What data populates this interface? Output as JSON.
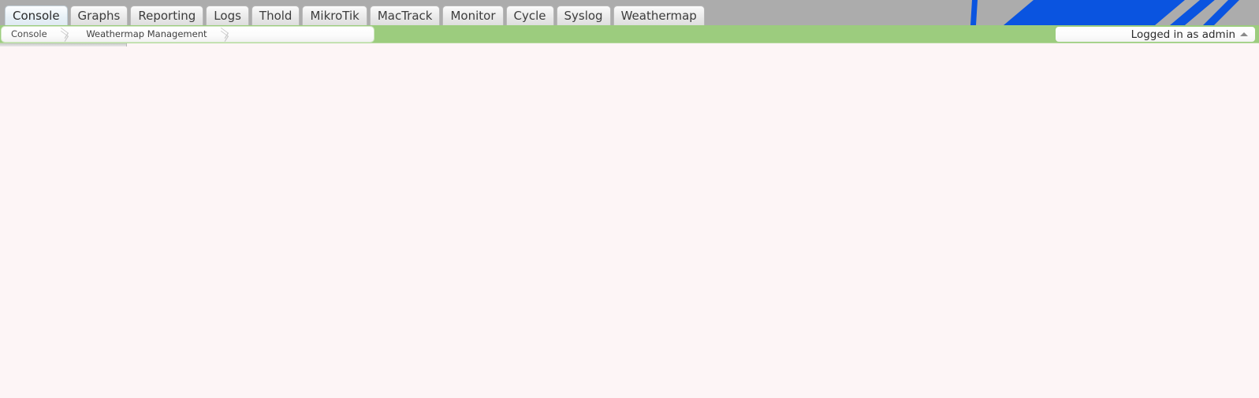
{
  "colors": {
    "tabbar_bg": "#acacac",
    "green_bar": "#9ccc7e",
    "page_bg": "#fdf5f6",
    "logo_blue": "#0a54e0",
    "logo_gray": "#acacac",
    "active_tab_bg": "#e8f1f7"
  },
  "tabs": {
    "items": [
      {
        "label": "Console",
        "name": "tab-console",
        "active": true
      },
      {
        "label": "Graphs",
        "name": "tab-graphs",
        "active": false
      },
      {
        "label": "Reporting",
        "name": "tab-reporting",
        "active": false
      },
      {
        "label": "Logs",
        "name": "tab-logs",
        "active": false
      },
      {
        "label": "Thold",
        "name": "tab-thold",
        "active": false
      },
      {
        "label": "MikroTik",
        "name": "tab-mikrotik",
        "active": false
      },
      {
        "label": "MacTrack",
        "name": "tab-mactrack",
        "active": false
      },
      {
        "label": "Monitor",
        "name": "tab-monitor",
        "active": false
      },
      {
        "label": "Cycle",
        "name": "tab-cycle",
        "active": false
      },
      {
        "label": "Syslog",
        "name": "tab-syslog",
        "active": false
      },
      {
        "label": "Weathermap",
        "name": "tab-weathermap",
        "active": false
      }
    ]
  },
  "breadcrumb": {
    "items": [
      {
        "label": "Console",
        "name": "breadcrumb-console"
      },
      {
        "label": "Weathermap Management",
        "name": "breadcrumb-weathermap-management"
      }
    ]
  },
  "user_menu": {
    "label": "Logged in as admin",
    "caret_icon": "caret-up-icon"
  },
  "logo": {
    "icon": "cacti-logo-icon"
  },
  "content": {
    "body_text": ""
  }
}
